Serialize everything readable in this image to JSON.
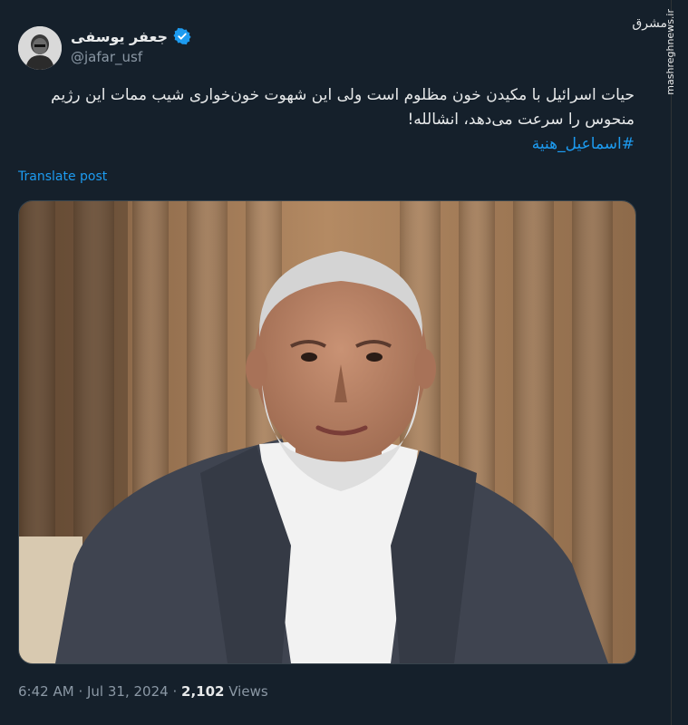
{
  "user": {
    "display_name": "جعفر یوسفی",
    "handle": "@jafar_usf"
  },
  "post": {
    "text": "حیات اسرائیل با مکیدن خون مظلوم است ولی این شهوت خون‌خواری شیب ممات این رژیم منحوس را سرعت می‌دهد، انشالله!",
    "hashtag": "#اسماعیل_هنیة",
    "translate_label": "Translate post"
  },
  "meta": {
    "time": "6:42 AM",
    "separator": "·",
    "date": "Jul 31, 2024",
    "views_count": "2,102",
    "views_label": "Views"
  },
  "watermark": {
    "site": "mashreghnews.ir",
    "logo": "مشرق"
  },
  "colors": {
    "background": "#15202b",
    "accent": "#1d9bf0",
    "text": "#e7e9ea",
    "muted": "#8b98a5"
  }
}
